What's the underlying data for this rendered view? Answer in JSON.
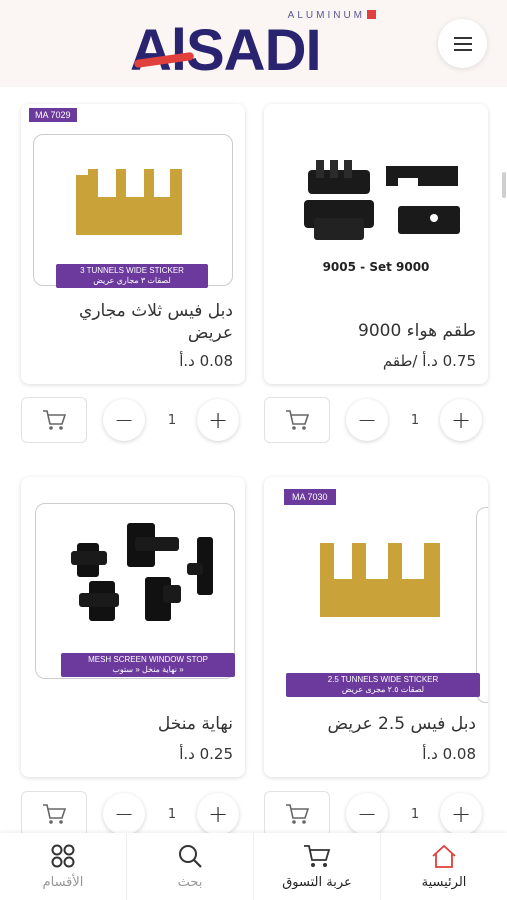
{
  "header": {
    "logo_small": "ALUMINUM",
    "logo_main": "AlSADI"
  },
  "products": [
    {
      "title": "دبل فيس ثلاث مجاري عريض",
      "price": "0.08 د.أ",
      "quantity": "1",
      "tag": "MA 7029",
      "sticker_en": "3 TUNNELS WIDE STICKER",
      "sticker_ar": "لصقات ٣ مجاري عريض"
    },
    {
      "title": "طقم هواء 9000",
      "price": "0.75 د.أ /طقم",
      "quantity": "1",
      "image_caption": "9005 - Set 9000"
    },
    {
      "title": "نهاية منخل",
      "price": "0.25 د.أ",
      "quantity": "1",
      "sticker_en": "MESH SCREEN WINDOW STOP",
      "sticker_ar": "نهاية منخل « ستوب »"
    },
    {
      "title": "دبل فيس 2.5 عريض",
      "price": "0.08 د.أ",
      "quantity": "1",
      "tag": "MA 7030",
      "sticker_en": "2.5 TUNNELS WIDE STICKER",
      "sticker_ar": "لصقات ٢.٥ مجرى عريض"
    }
  ],
  "bottom_nav": {
    "categories": "الأقسام",
    "search": "بحث",
    "cart": "عربة التسوق",
    "home": "الرئيسية"
  },
  "colors": {
    "brand_navy": "#2a2470",
    "brand_red": "#e0413c",
    "purple_tag": "#6c3a9c",
    "gold_part": "#c9a23a"
  },
  "icons": [
    "menu-icon",
    "cart-icon",
    "minus-icon",
    "plus-icon",
    "grid-icon",
    "search-icon",
    "home-icon"
  ]
}
